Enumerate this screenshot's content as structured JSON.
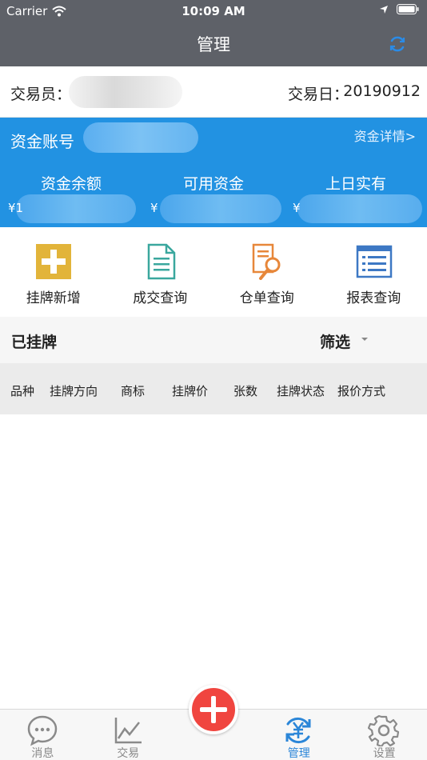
{
  "status_bar": {
    "carrier": "Carrier",
    "time": "10:09 AM"
  },
  "nav": {
    "title": "管理"
  },
  "trader": {
    "label": "交易员：",
    "date_label": "交易日：",
    "date_value": "20190912"
  },
  "account": {
    "label": "资金账号",
    "detail_link": "资金详情>",
    "columns": [
      {
        "label": "资金余额",
        "prefix": "¥1"
      },
      {
        "label": "可用资金",
        "prefix": "¥"
      },
      {
        "label": "上日实有",
        "prefix": "¥"
      }
    ]
  },
  "quick_actions": [
    {
      "label": "挂牌新增",
      "icon": "add-listing-icon"
    },
    {
      "label": "成交查询",
      "icon": "document-icon"
    },
    {
      "label": "仓单查询",
      "icon": "search-document-icon"
    },
    {
      "label": "报表查询",
      "icon": "report-list-icon"
    }
  ],
  "listing": {
    "title": "已挂牌",
    "filter_label": "筛选"
  },
  "table": {
    "headers": [
      "品种",
      "挂牌方向",
      "商标",
      "挂牌价",
      "张数",
      "挂牌状态",
      "报价方式"
    ]
  },
  "tabbar": {
    "items": [
      {
        "label": "消息",
        "icon": "chat-bubble-icon"
      },
      {
        "label": "交易",
        "icon": "line-chart-icon"
      },
      {
        "label": "管理",
        "icon": "yuan-refresh-icon",
        "active": true
      },
      {
        "label": "设置",
        "icon": "gear-icon"
      }
    ],
    "center_action": "add-icon"
  },
  "colors": {
    "header_bg": "#5e6168",
    "account_bg": "#2292e2",
    "active_tab": "#2b86d8",
    "fab": "#f0453f"
  }
}
